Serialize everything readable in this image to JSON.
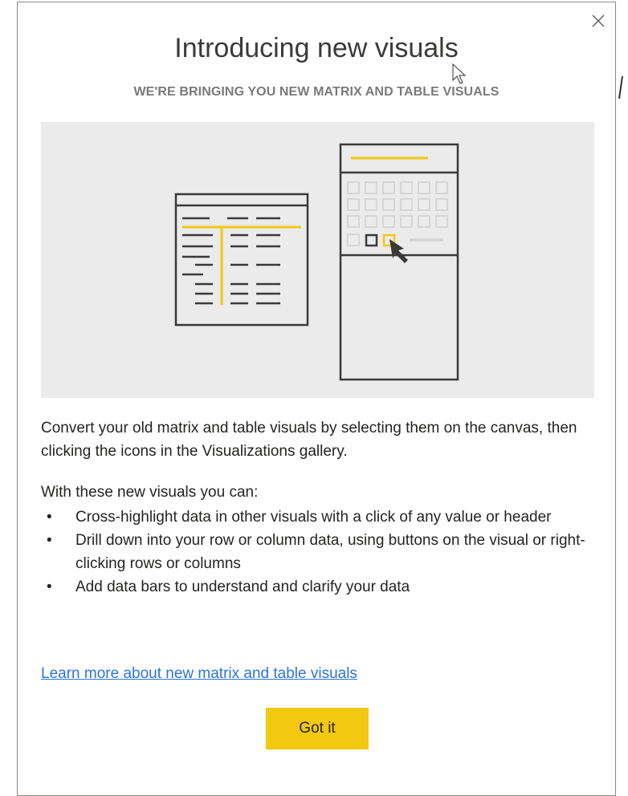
{
  "dialog": {
    "title": "Introducing new visuals",
    "subtitle": "WE'RE BRINGING YOU NEW MATRIX AND TABLE VISUALS",
    "close_icon": "close-icon",
    "illustration": {
      "background": "#ebebeb",
      "accent": "#f2c811",
      "line_color": "#3b3a39",
      "icons": [
        "table-visual-icon",
        "matrix-visual-icon",
        "pointer-icon"
      ]
    },
    "description": "Convert your old matrix and table visuals by selecting them on the canvas, then clicking the icons in the Visualizations gallery.",
    "lead": "With these new visuals you can:",
    "bullets": [
      "Cross-highlight data in other visuals with a click of any value or header",
      "Drill down into your row or column data, using buttons on the visual or right-clicking rows or columns",
      "Add data bars to understand and clarify your data"
    ],
    "learn_more_link": "Learn more about new matrix and table visuals",
    "got_it_label": "Got it",
    "colors": {
      "button": "#f2c811",
      "link": "#2d74da",
      "subtitle": "#7a7a7a"
    }
  }
}
